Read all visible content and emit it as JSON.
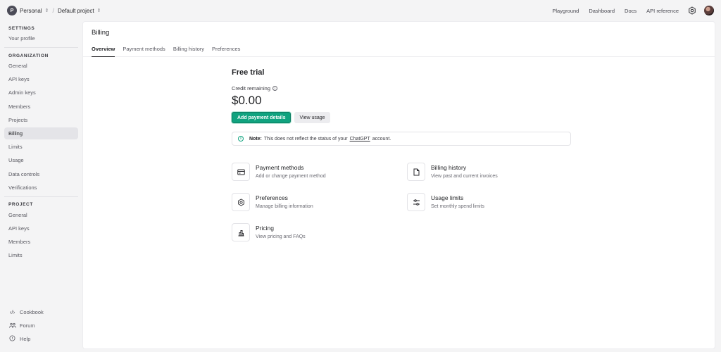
{
  "topbar": {
    "org_initial": "P",
    "org": "Personal",
    "project": "Default project",
    "links": [
      "Playground",
      "Dashboard",
      "Docs",
      "API reference"
    ]
  },
  "sidebar": {
    "settings_title": "SETTINGS",
    "settings_items": [
      "Your profile"
    ],
    "org_title": "ORGANIZATION",
    "org_items": [
      "General",
      "API keys",
      "Admin keys",
      "Members",
      "Projects",
      "Billing",
      "Limits",
      "Usage",
      "Data controls",
      "Verifications"
    ],
    "project_title": "PROJECT",
    "project_items": [
      "General",
      "API keys",
      "Members",
      "Limits"
    ],
    "bottom": [
      {
        "label": "Cookbook",
        "icon": "code-icon"
      },
      {
        "label": "Forum",
        "icon": "people-icon"
      },
      {
        "label": "Help",
        "icon": "help-icon"
      }
    ]
  },
  "main": {
    "title": "Billing",
    "tabs": [
      "Overview",
      "Payment methods",
      "Billing history",
      "Preferences"
    ],
    "free_trial": "Free trial",
    "credit_label": "Credit remaining",
    "amount": "$0.00",
    "add_payment": "Add payment details",
    "view_usage": "View usage",
    "note_bold": "Note:",
    "note_text": "This does not reflect the status of your",
    "note_link": "ChatGPT",
    "note_tail": "account.",
    "cards": [
      {
        "title": "Payment methods",
        "sub": "Add or change payment method",
        "icon": "credit-card-icon"
      },
      {
        "title": "Billing history",
        "sub": "View past and current invoices",
        "icon": "document-icon"
      },
      {
        "title": "Preferences",
        "sub": "Manage billing information",
        "icon": "settings-icon"
      },
      {
        "title": "Usage limits",
        "sub": "Set monthly spend limits",
        "icon": "sliders-icon"
      },
      {
        "title": "Pricing",
        "sub": "View pricing and FAQs",
        "icon": "chart-icon"
      }
    ]
  },
  "colors": {
    "accent": "#10a37f",
    "active_nav": "#e4e4e8"
  }
}
